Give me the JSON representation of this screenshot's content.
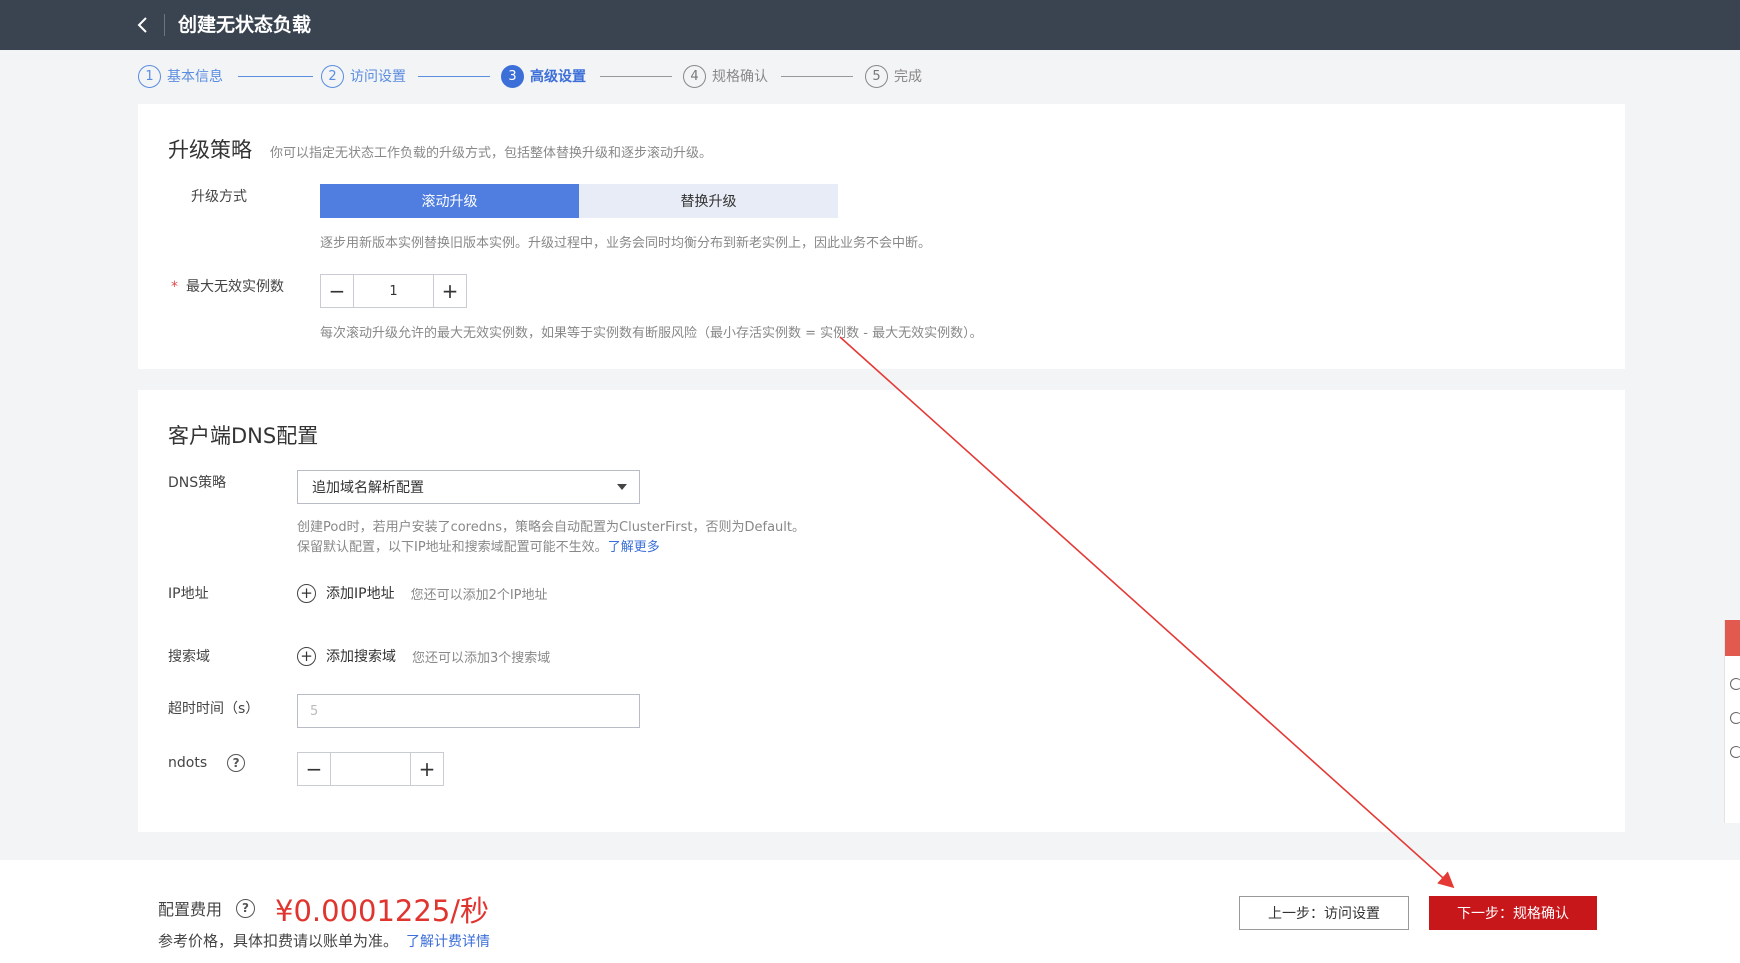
{
  "header": {
    "back_icon": "chevron-left-icon",
    "title": "创建无状态负载"
  },
  "steps": [
    {
      "num": "1",
      "label": "基本信息",
      "state": "done"
    },
    {
      "num": "2",
      "label": "访问设置",
      "state": "done"
    },
    {
      "num": "3",
      "label": "高级设置",
      "state": "active"
    },
    {
      "num": "4",
      "label": "规格确认",
      "state": "pending"
    },
    {
      "num": "5",
      "label": "完成",
      "state": "pending"
    }
  ],
  "upgrade": {
    "title": "升级策略",
    "desc": "你可以指定无状态工作负载的升级方式，包括整体替换升级和逐步滚动升级。",
    "mode_label": "升级方式",
    "mode_options": [
      "滚动升级",
      "替换升级"
    ],
    "mode_selected": "滚动升级",
    "mode_hint": "逐步用新版本实例替换旧版本实例。升级过程中，业务会同时均衡分布到新老实例上，因此业务不会中断。",
    "max_unavailable_label": "最大无效实例数",
    "max_unavailable_required": "*",
    "max_unavailable_value": "1",
    "max_unavailable_hint": "每次滚动升级允许的最大无效实例数，如果等于实例数有断服风险（最小存活实例数 = 实例数 - 最大无效实例数）。"
  },
  "dns": {
    "title": "客户端DNS配置",
    "policy_label": "DNS策略",
    "policy_value": "追加域名解析配置",
    "policy_hint_line1": "创建Pod时，若用户安装了coredns，策略会自动配置为ClusterFirst，否则为Default。",
    "policy_hint_line2": "保留默认配置，以下IP地址和搜索域配置可能不生效。",
    "learn_more": "了解更多",
    "ip_label": "IP地址",
    "ip_add": "添加IP地址",
    "ip_hint": "您还可以添加2个IP地址",
    "search_label": "搜索域",
    "search_add": "添加搜索域",
    "search_hint": "您还可以添加3个搜索域",
    "timeout_label": "超时时间（s）",
    "timeout_placeholder": "5",
    "ndots_label": "ndots",
    "ndots_value": ""
  },
  "footer": {
    "cost_label": "配置费用",
    "cost_value": "¥0.0001225/秒",
    "cost_note": "参考价格，具体扣费请以账单为准。",
    "cost_link": "了解计费详情",
    "prev_button": "上一步：访问设置",
    "next_button": "下一步：规格确认"
  },
  "colors": {
    "header_bg": "#3a4450",
    "accent": "#3c6fd8",
    "danger": "#c8171b",
    "price": "#e0342f",
    "annotation_arrow": "#e53935"
  }
}
